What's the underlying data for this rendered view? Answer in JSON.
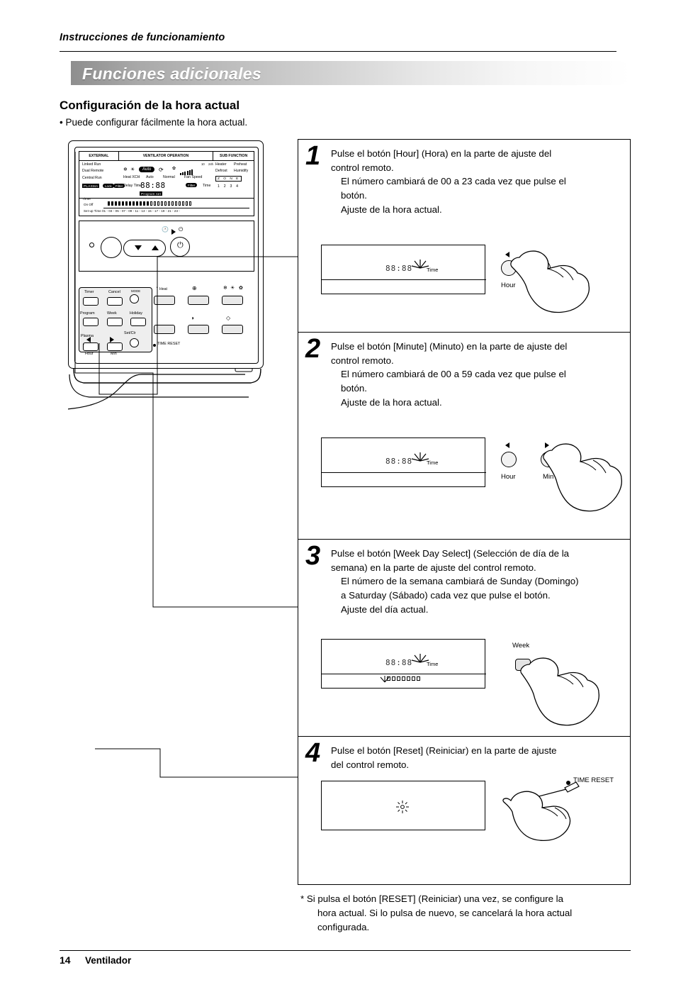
{
  "header": {
    "running_head": "Instrucciones de funcionamiento",
    "banner_title": "Funciones adicionales",
    "section_title": "Configuración de la hora actual",
    "bullet": "• Puede configurar fácilmente la hora actual."
  },
  "remote_panel": {
    "lcd": {
      "top_labels": [
        "EXTERNAL",
        "VENTILATOR OPERATION",
        "SUB FUNCTION"
      ],
      "left_rows": [
        "Linked Run",
        "Dual Remote",
        "Central Run"
      ],
      "mid_labels": [
        "Auto",
        "Heat XCH",
        "Auto",
        "Normal",
        "Fan Speed",
        "Delay Time",
        "Time"
      ],
      "sub_labels": [
        "Heater",
        "Defrost",
        "Preheat",
        "Humidify"
      ],
      "small_nums": [
        "10",
        "24h"
      ],
      "plasma_tag": "PLASMA",
      "plasma_side": [
        "Lock",
        "Filter"
      ],
      "zone_label": "Z O N E",
      "zone_numbers": "1 2 3 4",
      "segment_value": "88:88",
      "program_tag": "Program set",
      "filter_tag": "Filter",
      "timer_label": "Timer",
      "onoff_label": "On  Off",
      "scale_label": "Set-up Time   01 - 03 - 05 - 07 - 09 - 11 - 13 - 15 - 17 - 19 - 21 - 23 -"
    },
    "buttons": {
      "timer": "Timer",
      "cancel": "Cancel",
      "program": "Program",
      "week": "Week",
      "holiday": "Holiday",
      "plasma": "Plasma",
      "set_clr": "Set/Clr",
      "hour": "Hour",
      "min": "Min",
      "time_reset": "TIME RESET",
      "heat_exchange": "Heat"
    }
  },
  "steps": [
    {
      "num": "1",
      "lines": [
        "Pulse el botón [Hour] (Hora) en la parte de ajuste del",
        "control remoto."
      ],
      "indented": [
        "El número cambiará de 00 a 23 cada vez que pulse el",
        "botón.",
        "Ajuste de la hora actual."
      ],
      "display": {
        "segment": "88:88",
        "time_label": "Time"
      },
      "controls": [
        {
          "name": "hour",
          "label": "Hour"
        },
        {
          "name": "min",
          "label": ""
        }
      ]
    },
    {
      "num": "2",
      "lines": [
        "Pulse el botón [Minute] (Minuto) en la parte de ajuste del",
        "control remoto."
      ],
      "indented": [
        "El número cambiará de 00 a 59 cada vez que pulse el",
        "botón.",
        "Ajuste de la hora actual."
      ],
      "display": {
        "segment": "88:88",
        "time_label": "Time"
      },
      "controls": [
        {
          "name": "hour",
          "label": "Hour"
        },
        {
          "name": "min",
          "label": "Min"
        }
      ]
    },
    {
      "num": "3",
      "lines": [
        "Pulse el botón [Week Day Select] (Selección de día de la",
        "semana) en la parte de ajuste del control remoto."
      ],
      "indented": [
        "El número de la semana cambiará de Sunday (Domingo)",
        "a Saturday (Sábado) cada vez que pulse el botón.",
        "Ajuste del día actual."
      ],
      "display": {
        "segment": "88:88",
        "time_label": "Time"
      },
      "controls": [
        {
          "name": "week",
          "label": "Week"
        }
      ]
    },
    {
      "num": "4",
      "lines": [
        "Pulse el botón [Reset] (Reiniciar) en la parte de ajuste",
        "del control remoto."
      ],
      "indented": [],
      "display": {
        "segment": "",
        "time_label": ""
      },
      "controls": [
        {
          "name": "time-reset",
          "label": "TIME RESET"
        }
      ]
    }
  ],
  "footnote": {
    "line1": "*  Si pulsa el botón [RESET] (Reiniciar) una vez, se configure la",
    "line2": "hora actual. Si lo pulsa de nuevo, se cancelará la hora actual",
    "line3": "configurada."
  },
  "footer": {
    "page_number": "14",
    "label": "Ventilador"
  },
  "colors": {
    "ink": "#000000",
    "banner_start": "#8e8e8e",
    "banner_end": "#ffffff",
    "panel_gray": "#eeeeee"
  }
}
